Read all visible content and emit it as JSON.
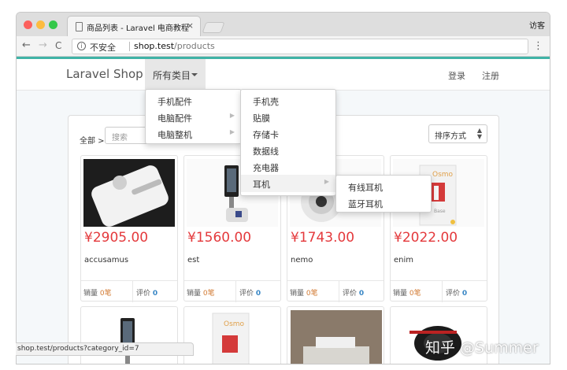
{
  "browser": {
    "tab_title": "商品列表 - Laravel 电商教程",
    "tab_close": "×",
    "guest_label": "访客",
    "security_label": "不安全",
    "url_host": "shop.test",
    "url_path": "/products",
    "status_url": "shop.test/products?category_id=7",
    "back_glyph": "←",
    "forward_glyph": "→",
    "reload_glyph": "C",
    "menu_glyph": "⋮"
  },
  "navbar": {
    "brand": "Laravel Shop",
    "categories_label": "所有类目",
    "login": "登录",
    "register": "注册"
  },
  "filters": {
    "breadcrumb": "全部 >",
    "search_placeholder": "搜索",
    "sort_label": "排序方式"
  },
  "menu": {
    "level1": [
      "手机配件",
      "电脑配件",
      "电脑整机"
    ],
    "level2": [
      "手机壳",
      "贴膜",
      "存储卡",
      "数据线",
      "充电器",
      "耳机"
    ],
    "level3": [
      "有线耳机",
      "蓝牙耳机"
    ],
    "submenu_arrow": "▶"
  },
  "products": [
    {
      "price": "¥2905.00",
      "name": "accusamus",
      "sales_label": "销量",
      "sales": "0笔",
      "rating_label": "评价",
      "rating": "0"
    },
    {
      "price": "¥1560.00",
      "name": "est",
      "sales_label": "销量",
      "sales": "0笔",
      "rating_label": "评价",
      "rating": "0"
    },
    {
      "price": "¥1743.00",
      "name": "nemo",
      "sales_label": "销量",
      "sales": "0笔",
      "rating_label": "评价",
      "rating": "0"
    },
    {
      "price": "¥2022.00",
      "name": "enim",
      "sales_label": "销量",
      "sales": "0笔",
      "rating_label": "评价",
      "rating": "0"
    }
  ],
  "watermark": "知乎 @Summer",
  "colors": {
    "accent": "#40b3a6",
    "price": "#e4393c",
    "sales": "#d27b34",
    "rating": "#3a87c5"
  }
}
